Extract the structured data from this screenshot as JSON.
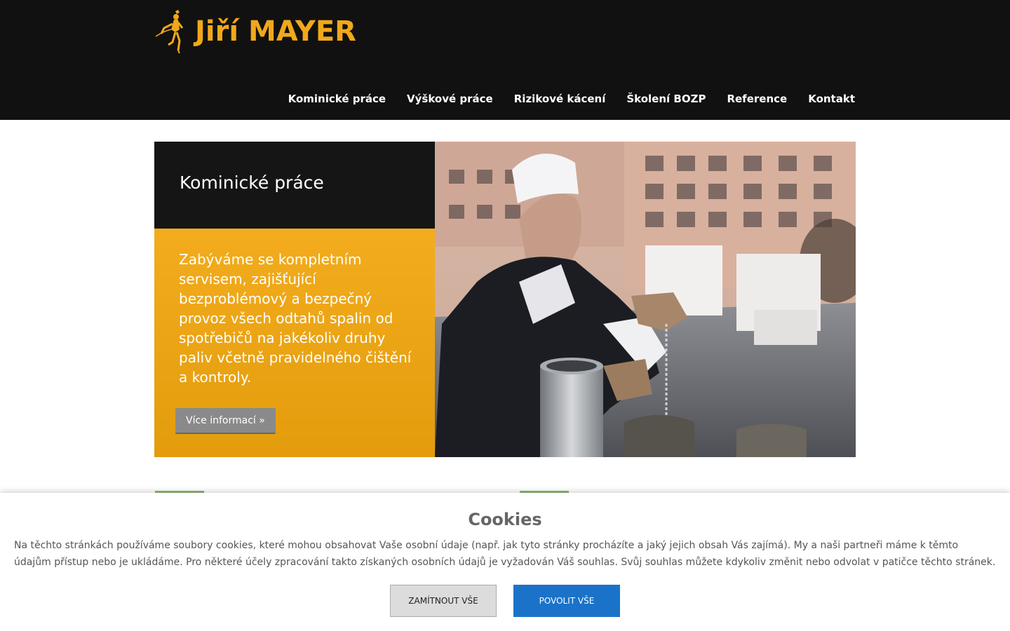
{
  "brand": {
    "name": "Jiří MAYER",
    "accent_color": "#f0a81b",
    "logo_icon": "climber-with-rope-icon"
  },
  "nav": {
    "items": [
      {
        "label": "Kominické práce"
      },
      {
        "label": "Výškové práce"
      },
      {
        "label": "Rizikové kácení"
      },
      {
        "label": "Školení BOZP"
      },
      {
        "label": "Reference"
      },
      {
        "label": "Kontakt"
      }
    ]
  },
  "hero": {
    "title": "Kominické práce",
    "text": "Zabýváme se kompletním servisem, zajišťující bezproblémový a bezpečný provoz všech odtahů spalin od spotřebičů na jakékoliv druhy paliv včetně pravidelného čištění a kontroly.",
    "button_label": "Více informací »",
    "photo": "chimney-sweep-on-roof-photo"
  },
  "cookies": {
    "title": "Cookies",
    "text": "Na těchto stránkách používáme soubory cookies, které mohou obsahovat Vaše osobní údaje (např. jak tyto stránky procházíte a jaký jejich obsah Vás zajímá). My a naši partneři máme k těmto údajům přístup nebo je ukládáme. Pro některé účely zpracování takto získaných osobních údajů je vyžadován Váš souhlas. Svůj souhlas můžete kdykoliv změnit nebo odvolat v patičce těchto stránek.",
    "reject_label": "ZAMÍTNOUT VŠE",
    "accept_label": "POVOLIT VŠE",
    "accept_color": "#1a73c9"
  }
}
